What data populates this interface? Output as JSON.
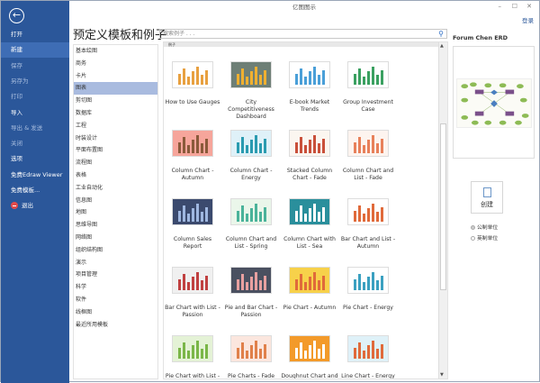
{
  "window": {
    "title": "亿图图示",
    "minimize": "–",
    "maximize": "☐",
    "close": "✕",
    "login": "登录"
  },
  "sidebar": {
    "items": [
      {
        "label": "打开",
        "state": "normal"
      },
      {
        "label": "新建",
        "state": "selected"
      },
      {
        "label": "保存",
        "state": "disabled"
      },
      {
        "label": "另存为",
        "state": "disabled"
      },
      {
        "label": "打印",
        "state": "disabled"
      },
      {
        "label": "导入",
        "state": "normal"
      },
      {
        "label": "导出 & 发送",
        "state": "disabled"
      },
      {
        "label": "关闭",
        "state": "disabled"
      },
      {
        "label": "选项",
        "state": "normal"
      },
      {
        "label": "免费Edraw Viewer",
        "state": "normal"
      },
      {
        "label": "免费模板...",
        "state": "normal"
      }
    ],
    "exit": "退出"
  },
  "main": {
    "title": "预定义模板和例子",
    "search_placeholder": "搜索例子 . . .",
    "categories": [
      "基本绘图",
      "商务",
      "卡片",
      "图表",
      "剪切图",
      "数据库",
      "工程",
      "时装设计",
      "平面布置图",
      "流程图",
      "表格",
      "工业自动化",
      "信息图",
      "地图",
      "思维导图",
      "网络图",
      "组织结构图",
      "演示",
      "项目管理",
      "科学",
      "软件",
      "线框图",
      "最近所用模板"
    ],
    "selected_category": "图表",
    "section_label": "例子",
    "templates": [
      {
        "label": "How to Use Gauges",
        "bg": "#ffffff",
        "accent": "#e8a040"
      },
      {
        "label": "City Competitiveness Dashboard",
        "bg": "#6e7f76",
        "accent": "#f0b030"
      },
      {
        "label": "E-book Market Trends",
        "bg": "#ffffff",
        "accent": "#4a9fd8"
      },
      {
        "label": "Group Investment Case",
        "bg": "#ffffff",
        "accent": "#3aa060"
      },
      {
        "label": "Column Chart - Autumn",
        "bg": "#f6a59b",
        "accent": "#8a5a3a"
      },
      {
        "label": "Column Chart - Energy",
        "bg": "#dff1f8",
        "accent": "#2a9bb0"
      },
      {
        "label": "Stacked Column Chart - Fade",
        "bg": "#fbf6f0",
        "accent": "#c9503a"
      },
      {
        "label": "Column Chart and List - Fade",
        "bg": "#fdf4ef",
        "accent": "#e8805a"
      },
      {
        "label": "Column Sales Report",
        "bg": "#3b4a6e",
        "accent": "#9fb7e0"
      },
      {
        "label": "Column Chart and List - Spring",
        "bg": "#eaf6ea",
        "accent": "#4ab39a"
      },
      {
        "label": "Column Chart with List - Sea",
        "bg": "#2a8f9c",
        "accent": "#ffffff"
      },
      {
        "label": "Bar Chart and List - Autumn",
        "bg": "#ffffff",
        "accent": "#e06a3a"
      },
      {
        "label": "Bar Chart with List - Passion",
        "bg": "#f0f0f0",
        "accent": "#c04040"
      },
      {
        "label": "Pie and Bar Chart - Passion",
        "bg": "#4a5060",
        "accent": "#e8a0a0"
      },
      {
        "label": "Pie Chart - Autumn",
        "bg": "#f7d14a",
        "accent": "#e06a3a"
      },
      {
        "label": "Pie Chart - Energy",
        "bg": "#ffffff",
        "accent": "#3aa0c0"
      },
      {
        "label": "Pie Chart with List -",
        "bg": "#e4f2d6",
        "accent": "#7ab648"
      },
      {
        "label": "Pie Charts - Fade",
        "bg": "#fbe6de",
        "accent": "#e0804a"
      },
      {
        "label": "Doughnut Chart and",
        "bg": "#f39a2a",
        "accent": "#ffffff"
      },
      {
        "label": "Line Chart - Energy",
        "bg": "#dff1f8",
        "accent": "#e06a3a"
      }
    ]
  },
  "preview": {
    "title": "Forum Chen ERD",
    "create": "创建",
    "units": [
      {
        "label": "公制单位",
        "checked": true
      },
      {
        "label": "英制单位",
        "checked": false
      }
    ]
  },
  "colors": {
    "sidebar": "#2b579a",
    "selected_category": "#a9bbdf"
  }
}
